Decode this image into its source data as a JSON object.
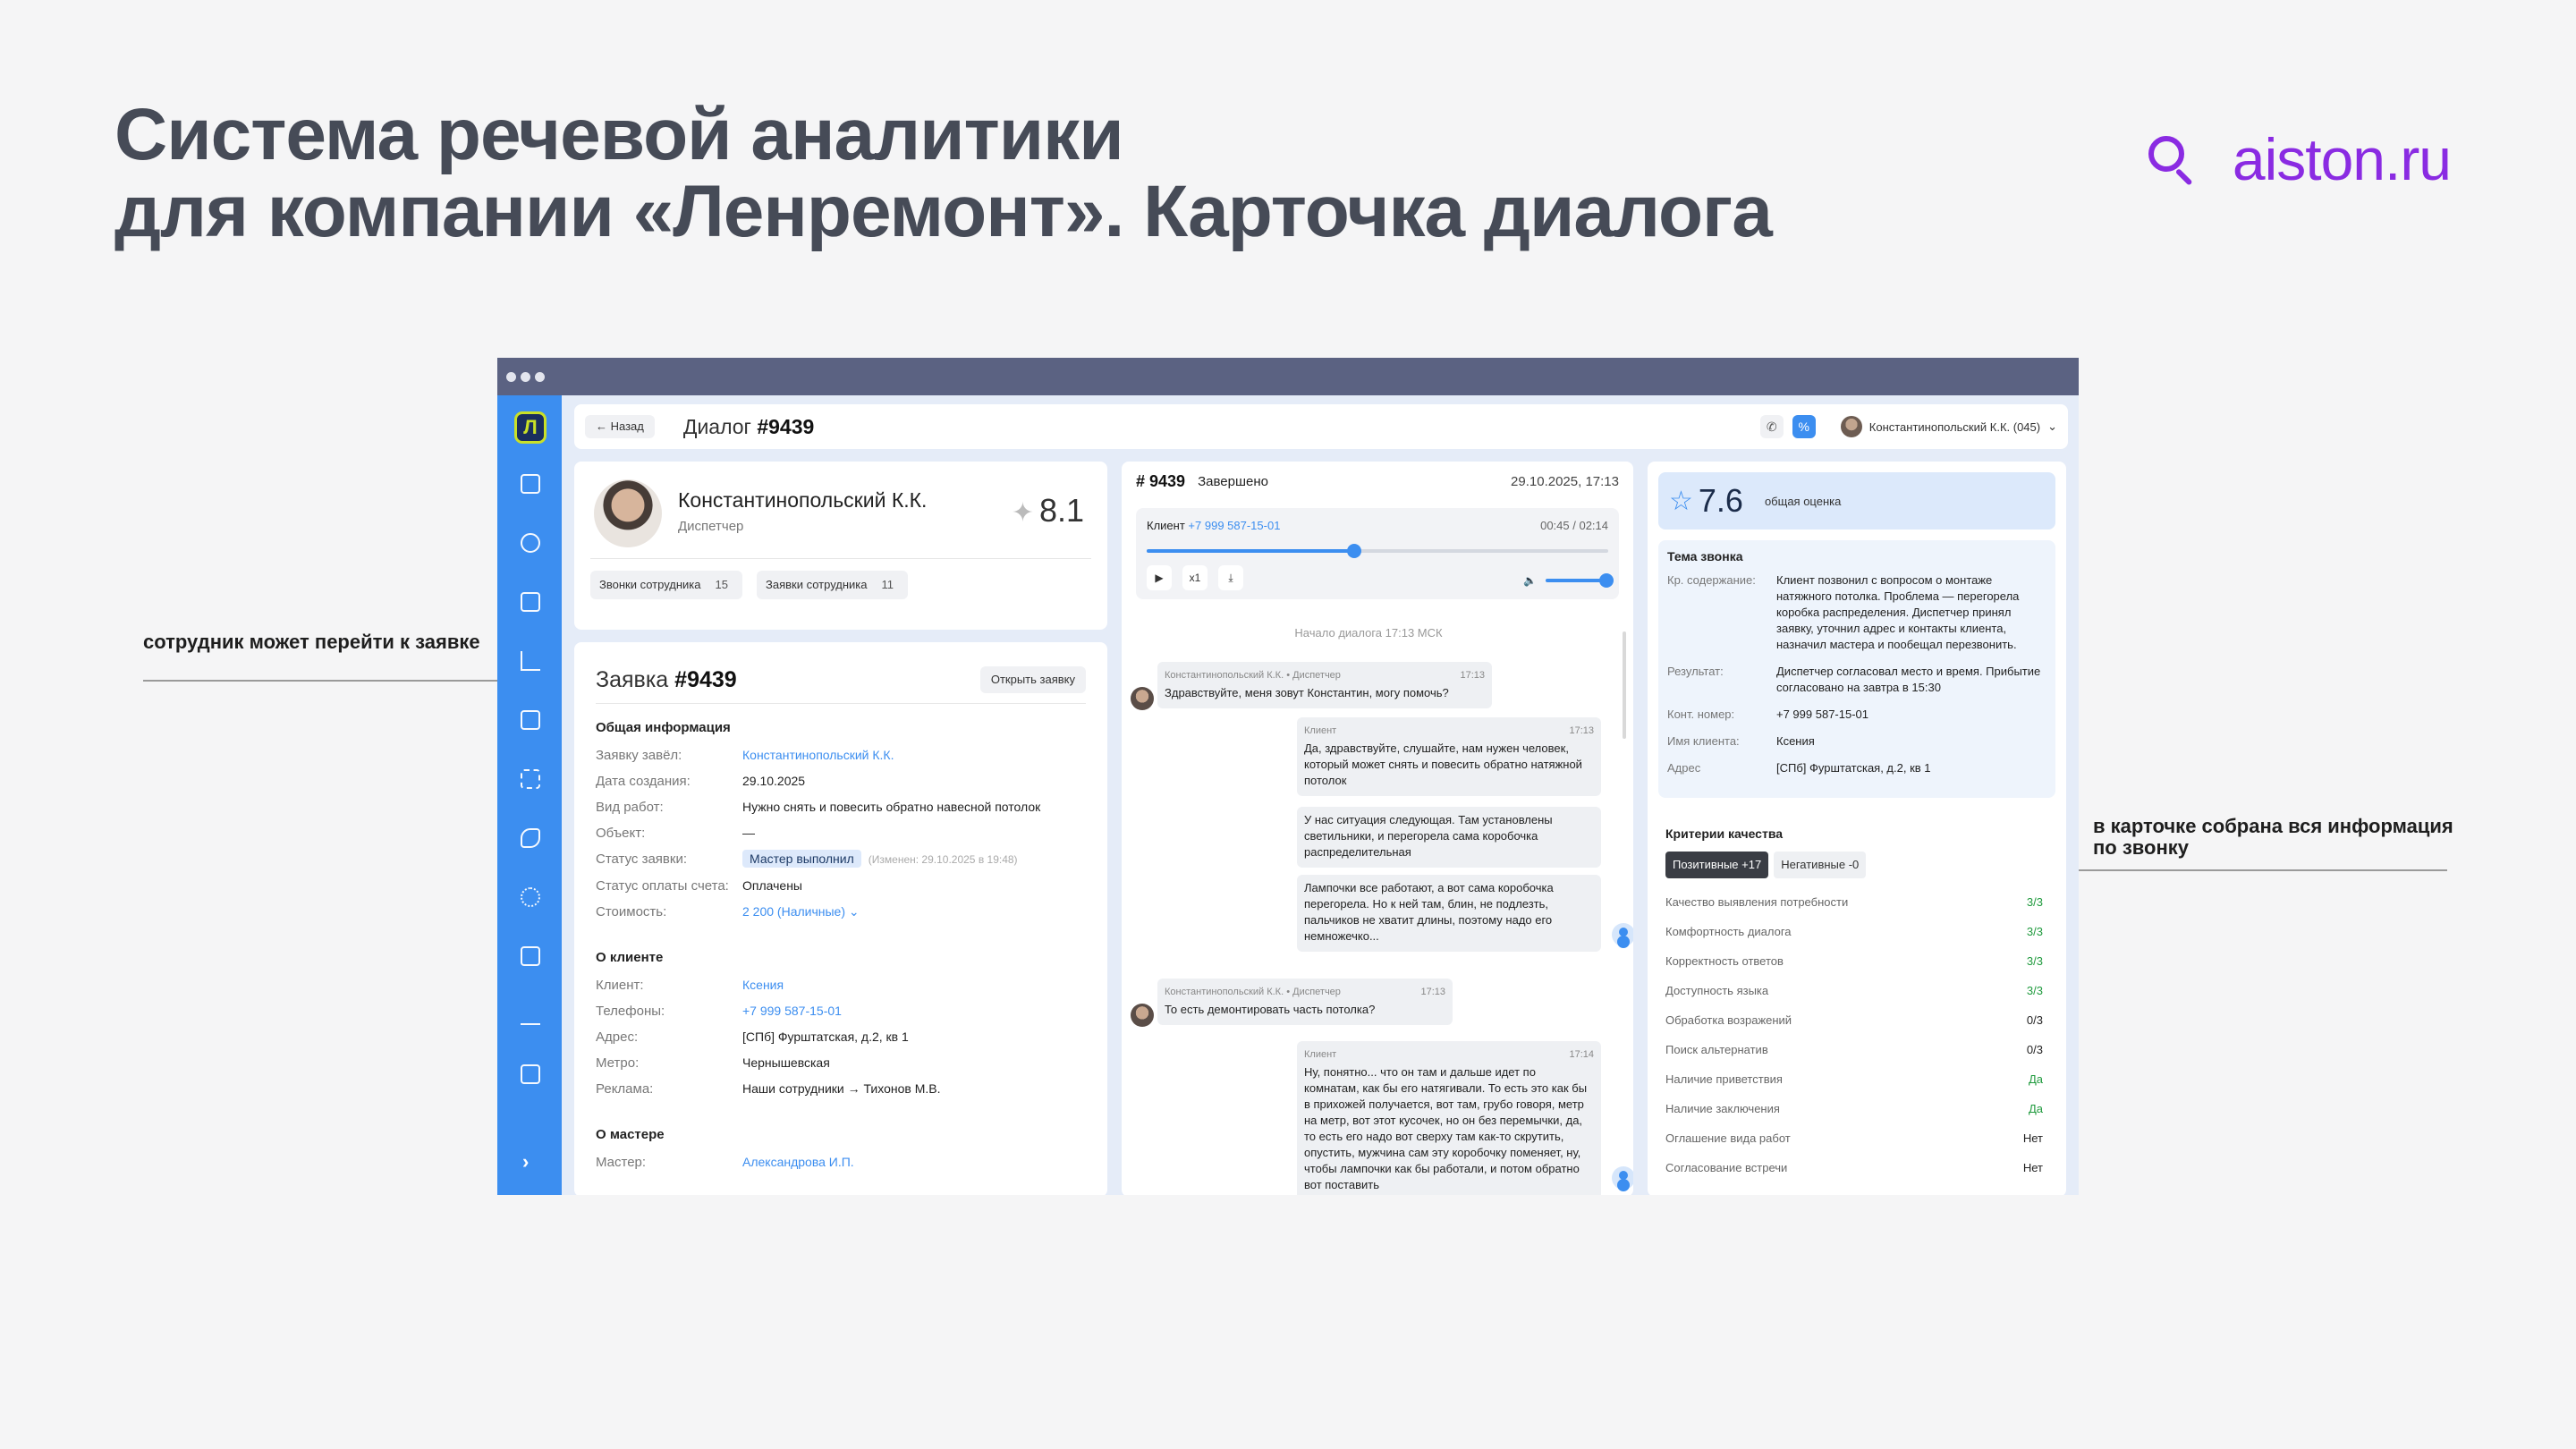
{
  "slide": {
    "title_line1": "Система речевой аналитики",
    "title_line2": "для компании «Ленремонт». Карточка диалога",
    "brand": "aiston.ru",
    "note_left": "сотрудник может перейти к заявке",
    "note_right_line1": "в карточке собрана вся информация",
    "note_right_line2": "по звонку"
  },
  "colors": {
    "accent": "#3c8ef0",
    "brand": "#8a2be2",
    "ok": "#1f9a3d"
  },
  "sidebar": {
    "logo": "Л",
    "icons": [
      "document-icon",
      "users-icon",
      "briefcase-icon",
      "chart-icon",
      "file-icon",
      "grid-icon",
      "phone-icon",
      "gear-icon",
      "paint-roller-icon",
      "edit-icon",
      "note-icon"
    ],
    "expand": "›"
  },
  "header": {
    "back": "← Назад",
    "title_prefix": "Диалог",
    "title_num": "#9439",
    "user": "Константинопольский К.К. (045)"
  },
  "profile": {
    "name": "Константинопольский К.К.",
    "role": "Диспетчер",
    "score": "8.1",
    "chip_calls": "Звонки сотрудника",
    "chip_calls_count": "15",
    "chip_orders": "Заявки сотрудника",
    "chip_orders_count": "11"
  },
  "order": {
    "title_prefix": "Заявка",
    "title_num": "#9439",
    "open_btn": "Открыть заявку",
    "general_title": "Общая информация",
    "general": [
      {
        "k": "Заявку завёл:",
        "v": "Константинопольский К.К."
      },
      {
        "k": "Дата создания:",
        "v": "29.10.2025"
      },
      {
        "k": "Вид работ:",
        "v": "Нужно снять и повесить обратно навесной потолок"
      },
      {
        "k": "Объект:",
        "v": "—"
      },
      {
        "k": "Статус заявки:",
        "v": "Мастер выполнил",
        "extra": "(Изменен: 29.10.2025 в 19:48)"
      },
      {
        "k": "Статус оплаты счета:",
        "v": "Оплачены"
      },
      {
        "k": "Стоимость:",
        "v": "2 200 (Наличные) ⌄"
      }
    ],
    "client_title": "О клиенте",
    "client": [
      {
        "k": "Клиент:",
        "v": "Ксения"
      },
      {
        "k": "Телефоны:",
        "v": "+7 999 587-15-01"
      },
      {
        "k": "Адрес:",
        "v": "[СПб] Фурштатская, д.2, кв 1"
      },
      {
        "k": "Метро:",
        "v": "Чернышевская"
      },
      {
        "k": "Реклама:",
        "v": "Наши сотрудники → Тихонов М.В."
      }
    ],
    "master_title": "О мастере",
    "master": [
      {
        "k": "Мастер:",
        "v": "Александрова И.П."
      }
    ]
  },
  "dialog": {
    "num": "# 9439",
    "status": "Завершено",
    "date": "29.10.2025, 17:13",
    "player": {
      "label": "Клиент",
      "phone": "+7 999 587-15-01",
      "time": "00:45 / 02:14",
      "progress": 0.45,
      "speed": "x1",
      "volume": 1.0
    },
    "start": "Начало диалога   17:13 МСК",
    "messages": [
      {
        "who": "op",
        "author": "Константинопольский К.К. • Диспетчер",
        "time": "17:13",
        "text": "Здравствуйте, меня зовут Константин, могу помочь?"
      },
      {
        "who": "cl",
        "author": "Клиент",
        "time": "17:13",
        "text": "Да, здравствуйте, слушайте, нам нужен человек, который может снять и повесить обратно натяжной потолок"
      },
      {
        "who": "cl",
        "author": "",
        "time": "",
        "text": "У нас ситуация следующая. Там установлены светильники, и перегорела сама коробочка распределительная"
      },
      {
        "who": "cl",
        "author": "",
        "time": "",
        "text": "Лампочки все работают, а вот сама коробочка перегорела. Но к ней там, блин, не подлезть, пальчиков не хватит длины, поэтому надо его немножечко..."
      },
      {
        "who": "op",
        "author": "Константинопольский К.К. • Диспетчер",
        "time": "17:13",
        "text": "То есть демонтировать часть потолка?"
      },
      {
        "who": "cl",
        "author": "Клиент",
        "time": "17:14",
        "text": "Ну, понятно... что он там и дальше идет по комнатам, как бы его натягивали. То есть это как бы в прихожей получается, вот там, грубо говоря, метр на метр, вот этот кусочек, но он без перемычки, да, то есть его надо вот сверху там как-то скрутить, опустить, мужчина сам эту коробочку поменяет, ну, чтобы лампочки как бы работали, и потом обратно вот поставить"
      }
    ]
  },
  "analysis": {
    "score": "7.6",
    "score_label": "общая оценка",
    "theme_title": "Тема звонка",
    "theme": [
      {
        "k": "Кр. содержание:",
        "v": "Клиент позвонил с вопросом о монтаже натяжного потолка. Проблема — перегорела коробка распределения. Диспетчер принял заявку, уточнил адрес и контакты клиента, назначил мастера и пообещал перезвонить."
      },
      {
        "k": "Результат:",
        "v": "Диспетчер согласовал место и время. Прибытие согласовано на завтра в 15:30"
      },
      {
        "k": "Конт. номер:",
        "v": "+7 999 587-15-01"
      },
      {
        "k": "Имя клиента:",
        "v": "Ксения"
      },
      {
        "k": "Адрес",
        "v": "[СПб] Фурштатская, д.2, кв 1"
      }
    ],
    "criteria_title": "Критерии качества",
    "tab_positive": "Позитивные +17",
    "tab_negative": "Негативные -0",
    "criteria": [
      {
        "k": "Качество выявления потребности",
        "v": "3/3",
        "ok": true
      },
      {
        "k": "Комфортность диалога",
        "v": "3/3",
        "ok": true
      },
      {
        "k": "Корректность ответов",
        "v": "3/3",
        "ok": true
      },
      {
        "k": "Доступность языка",
        "v": "3/3",
        "ok": true
      },
      {
        "k": "Обработка возражений",
        "v": "0/3",
        "ok": false
      },
      {
        "k": "Поиск альтернатив",
        "v": "0/3",
        "ok": false
      },
      {
        "k": "Наличие приветствия",
        "v": "Да",
        "ok": true
      },
      {
        "k": "Наличие заключения",
        "v": "Да",
        "ok": true
      },
      {
        "k": "Оглашение вида работ",
        "v": "Нет",
        "ok": false
      },
      {
        "k": "Согласование встречи",
        "v": "Нет",
        "ok": false
      }
    ]
  }
}
